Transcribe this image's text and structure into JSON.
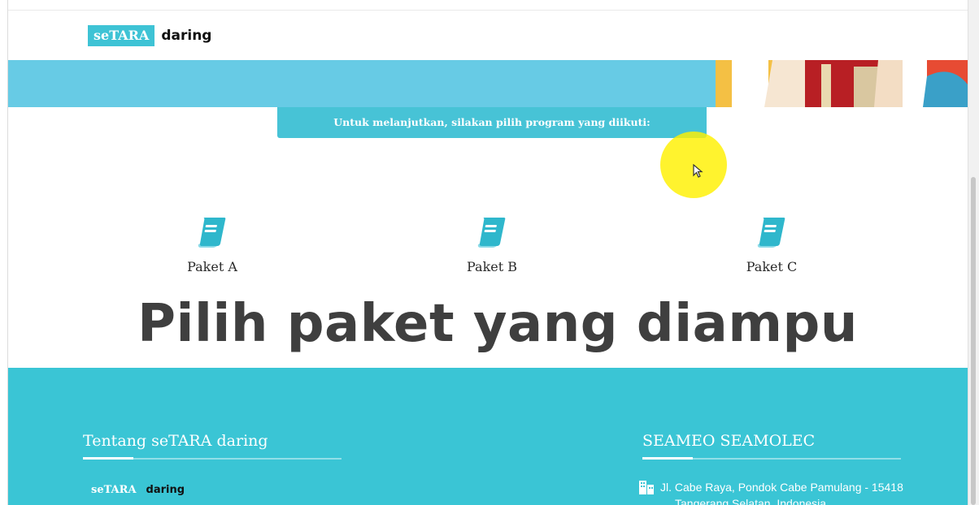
{
  "header": {
    "logo_se": "seTARA",
    "logo_daring": "daring"
  },
  "banner": {
    "prompt": "Untuk melanjutkan, silakan pilih program yang diikuti:"
  },
  "packages": [
    {
      "label": "Paket A",
      "icon": "book-icon"
    },
    {
      "label": "Paket B",
      "icon": "book-icon"
    },
    {
      "label": "Paket C",
      "icon": "book-icon"
    }
  ],
  "overlay_title": "Pilih paket yang diampu",
  "footer": {
    "about_title": "Tentang seTARA daring",
    "logo_se": "seTARA",
    "logo_daring": "daring",
    "contact_title": "SEAMEO SEAMOLEC",
    "address_line1": "Jl. Cabe Raya, Pondok Cabe Pamulang - 15418",
    "address_line2": "Tangerang Selatan, Indonesia"
  },
  "colors": {
    "brand_cyan": "#3ec3d5",
    "banner_blue": "#67cbe5",
    "cursor_highlight": "#fff000"
  }
}
